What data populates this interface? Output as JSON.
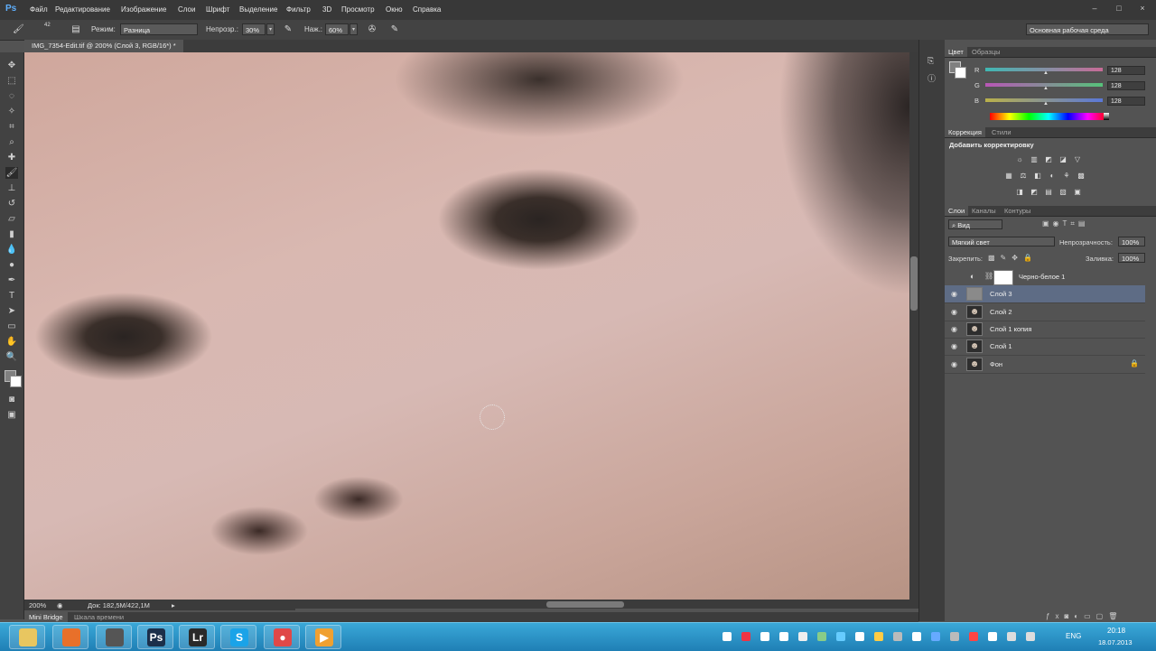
{
  "app": {
    "logo": "Ps",
    "menu": [
      "Файл",
      "Редактирование",
      "Изображение",
      "Слои",
      "Шрифт",
      "Выделение",
      "Фильтр",
      "3D",
      "Просмотр",
      "Окно",
      "Справка"
    ],
    "window_controls": [
      "–",
      "□",
      "×"
    ]
  },
  "options_bar": {
    "brush_size": "42",
    "mode_label": "Режим:",
    "mode_value": "Разница",
    "opacity_label": "Непрозр.:",
    "opacity_value": "30%",
    "pressure_label": "Наж.:",
    "pressure_value": "60%",
    "workspace": "Основная рабочая среда"
  },
  "document": {
    "tab_title": "IMG_7354-Edit.tif @ 200% (Слой 3, RGB/16*) *",
    "zoom": "200%",
    "doc_size": "Док: 182,5M/422,1M"
  },
  "bottom_tabs": [
    "Mini Bridge",
    "Шкала времени"
  ],
  "color_panel": {
    "tabs": [
      "Цвет",
      "Образцы"
    ],
    "channels": [
      {
        "label": "R",
        "value": "128",
        "gradient": "linear-gradient(90deg,#3fb8b3,#c86b97)"
      },
      {
        "label": "G",
        "value": "128",
        "gradient": "linear-gradient(90deg,#b856b6,#56c27a)"
      },
      {
        "label": "B",
        "value": "128",
        "gradient": "linear-gradient(90deg,#b9b04a,#5a78d8)"
      }
    ]
  },
  "adjustments_panel": {
    "tabs": [
      "Коррекция",
      "Стили"
    ],
    "title": "Добавить корректировку",
    "row1": [
      "☼",
      "▥",
      "◩",
      "◪",
      "▽"
    ],
    "row2": [
      "▦",
      "⚖",
      "◧",
      "◐",
      "⚘",
      "▩"
    ],
    "row3": [
      "◨",
      "◩",
      "▤",
      "▧",
      "▣"
    ]
  },
  "layers_panel": {
    "tabs": [
      "Слои",
      "Каналы",
      "Контуры"
    ],
    "filter": "Вид",
    "blend_mode": "Мягкий свет",
    "opacity_label": "Непрозрачность:",
    "opacity_value": "100%",
    "lock_label": "Закрепить:",
    "fill_label": "Заливка:",
    "fill_value": "100%",
    "layers": [
      {
        "name": "Черно-белое 1",
        "visible": false,
        "selected": false,
        "kind": "adjustment"
      },
      {
        "name": "Слой 3",
        "visible": true,
        "selected": true,
        "kind": "gray"
      },
      {
        "name": "Слой 2",
        "visible": true,
        "selected": false,
        "kind": "photo"
      },
      {
        "name": "Слой 1 копия",
        "visible": true,
        "selected": false,
        "kind": "photo"
      },
      {
        "name": "Слой 1",
        "visible": true,
        "selected": false,
        "kind": "photo"
      },
      {
        "name": "Фон",
        "visible": true,
        "selected": false,
        "kind": "photo",
        "locked": true
      }
    ]
  },
  "taskbar": {
    "apps": [
      {
        "name": "explorer",
        "label": "",
        "color": "#e8c660"
      },
      {
        "name": "firefox",
        "label": "",
        "color": "#e8702a"
      },
      {
        "name": "world-of-tanks",
        "label": "",
        "color": "#555"
      },
      {
        "name": "photoshop",
        "label": "Ps",
        "color": "#1c2f4a"
      },
      {
        "name": "lightroom",
        "label": "Lr",
        "color": "#2a2a2a"
      },
      {
        "name": "skype",
        "label": "S",
        "color": "#1aa3e8"
      },
      {
        "name": "recorder",
        "label": "●",
        "color": "#e04848"
      },
      {
        "name": "player",
        "label": "▶",
        "color": "#f0a030"
      }
    ],
    "lang": "ENG",
    "time": "20:18",
    "date": "18.07.2013"
  }
}
